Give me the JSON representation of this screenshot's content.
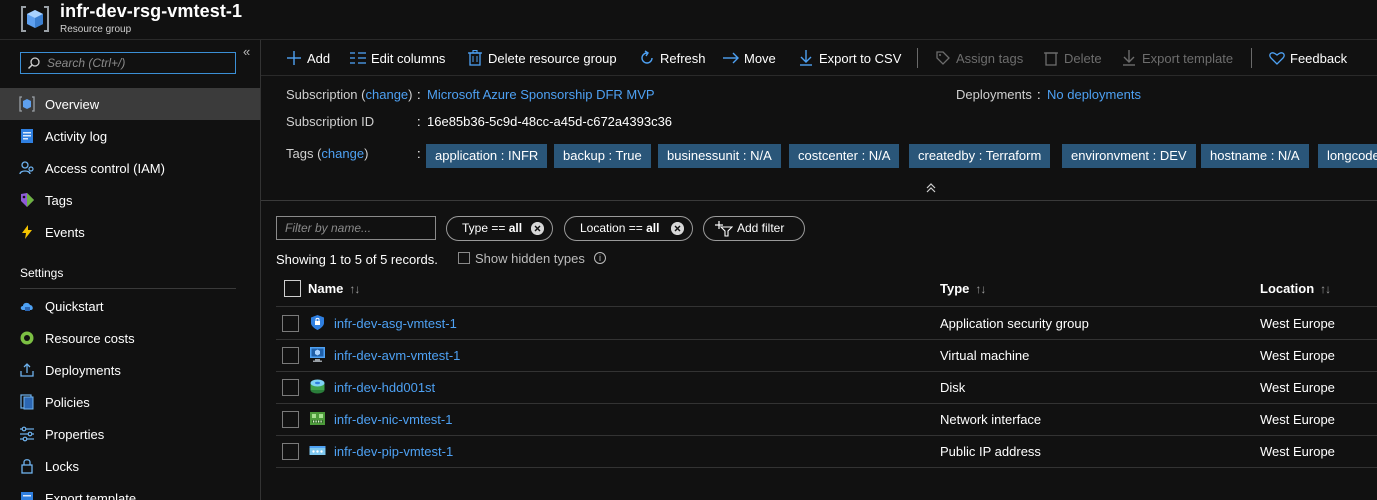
{
  "header": {
    "title": "infr-dev-rsg-vmtest-1",
    "subtitle": "Resource group"
  },
  "sidebar": {
    "search_placeholder": "Search (Ctrl+/)",
    "collapse_glyph": "«",
    "items": [
      {
        "label": "Overview",
        "icon": "resource-group-icon"
      },
      {
        "label": "Activity log",
        "icon": "activity-log-icon"
      },
      {
        "label": "Access control (IAM)",
        "icon": "iam-icon"
      },
      {
        "label": "Tags",
        "icon": "tag-icon"
      },
      {
        "label": "Events",
        "icon": "lightning-icon"
      }
    ],
    "settings_header": "Settings",
    "settings_items": [
      {
        "label": "Quickstart",
        "icon": "cloud-icon"
      },
      {
        "label": "Resource costs",
        "icon": "cost-icon"
      },
      {
        "label": "Deployments",
        "icon": "deployments-icon"
      },
      {
        "label": "Policies",
        "icon": "policies-icon"
      },
      {
        "label": "Properties",
        "icon": "properties-icon"
      },
      {
        "label": "Locks",
        "icon": "lock-icon"
      },
      {
        "label": "Export template",
        "icon": "export-template-icon"
      }
    ]
  },
  "toolbar": {
    "add": "Add",
    "edit_columns": "Edit columns",
    "delete_rg": "Delete resource group",
    "refresh": "Refresh",
    "move": "Move",
    "export_csv": "Export to CSV",
    "assign_tags": "Assign tags",
    "delete": "Delete",
    "export_template": "Export template",
    "feedback": "Feedback"
  },
  "essentials": {
    "subscription_label": "Subscription",
    "change": "change",
    "subscription_value": "Microsoft Azure Sponsorship DFR MVP",
    "subscription_id_label": "Subscription ID",
    "subscription_id_value": "16e85b36-5c9d-48cc-a45d-c672a4393c36",
    "tags_label": "Tags",
    "deployments_label": "Deployments",
    "deployments_value": "No deployments",
    "tags": [
      "application : INFR",
      "backup : True",
      "businessunit : N/A",
      "costcenter : N/A",
      "createdby : Terraform",
      "environvment : DEV",
      "hostname : N/A",
      "longcode"
    ]
  },
  "filters": {
    "name_placeholder": "Filter by name...",
    "type_prefix": "Type == ",
    "type_value": "all",
    "location_prefix": "Location == ",
    "location_value": "all",
    "add_filter": "Add filter",
    "records_text": "Showing 1 to 5 of 5 records.",
    "show_hidden": "Show hidden types"
  },
  "table": {
    "columns": {
      "name": "Name",
      "type": "Type",
      "location": "Location"
    },
    "rows": [
      {
        "name": "infr-dev-asg-vmtest-1",
        "type": "Application security group",
        "location": "West Europe",
        "icon": "asg-icon"
      },
      {
        "name": "infr-dev-avm-vmtest-1",
        "type": "Virtual machine",
        "location": "West Europe",
        "icon": "vm-icon"
      },
      {
        "name": "infr-dev-hdd001st",
        "type": "Disk",
        "location": "West Europe",
        "icon": "disk-icon"
      },
      {
        "name": "infr-dev-nic-vmtest-1",
        "type": "Network interface",
        "location": "West Europe",
        "icon": "nic-icon"
      },
      {
        "name": "infr-dev-pip-vmtest-1",
        "type": "Public IP address",
        "location": "West Europe",
        "icon": "public-ip-icon"
      }
    ]
  },
  "colors": {
    "accent": "#4ea1f3",
    "tag_bg": "#2a5679",
    "active_nav": "#3b3b3b",
    "background": "#111111"
  }
}
